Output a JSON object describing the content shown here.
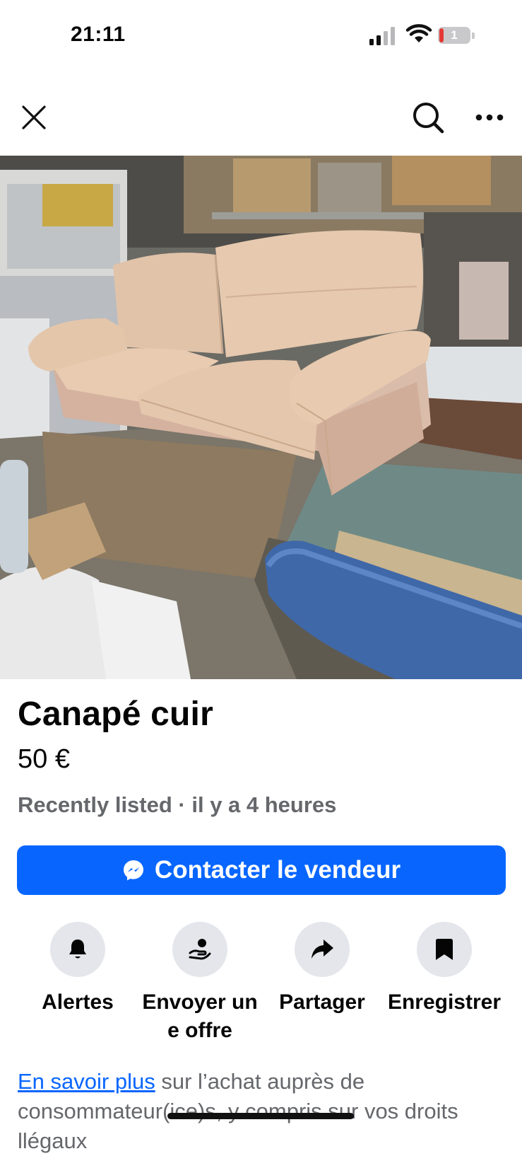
{
  "status_bar": {
    "time": "21:11",
    "battery_level": "1",
    "icons": [
      "cellular-signal-icon",
      "wifi-icon",
      "battery-icon"
    ]
  },
  "nav": {
    "icons": [
      "close-icon",
      "search-icon",
      "more-icon"
    ]
  },
  "photo": {
    "carousel_count": 8,
    "carousel_active": 2
  },
  "listing": {
    "title": "Canapé cuir",
    "price": "50 €",
    "meta": "Recently listed · il y a 4 heures"
  },
  "contact_button": {
    "label": "Contacter le vendeur",
    "icon": "messenger-icon"
  },
  "actions": [
    {
      "label": "Alertes",
      "icon": "bell-icon"
    },
    {
      "label": "Envoyer une offre",
      "icon": "offer-icon"
    },
    {
      "label": "Partager",
      "icon": "share-icon"
    },
    {
      "label": "Enregistrer",
      "icon": "bookmark-icon"
    }
  ],
  "footer": {
    "link_text": "En savoir plus",
    "text": " sur l’achat auprès de consommateur(ice)s, y compris sur vos droits llégaux"
  },
  "colors": {
    "accent": "#0866ff",
    "secondary_text": "#65676b",
    "action_bg": "#e4e6eb"
  }
}
